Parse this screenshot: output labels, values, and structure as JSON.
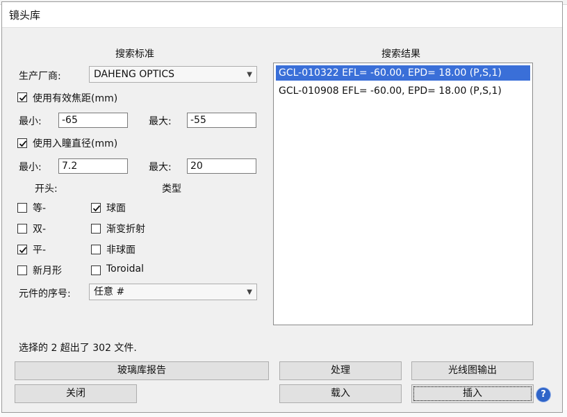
{
  "window": {
    "title": "镜头库"
  },
  "criteria": {
    "heading": "搜索标准",
    "manufacturer_label": "生产厂商:",
    "manufacturer_value": "DAHENG OPTICS",
    "use_efl_label": "使用有效焦距(mm)",
    "use_efl_checked": true,
    "efl_min_label": "最小:",
    "efl_min_value": "-65",
    "efl_max_label": "最大:",
    "efl_max_value": "-55",
    "use_epd_label": "使用入瞳直径(mm)",
    "use_epd_checked": true,
    "epd_min_label": "最小:",
    "epd_min_value": "7.2",
    "epd_max_label": "最大:",
    "epd_max_value": "20",
    "start_heading": "开头:",
    "type_heading": "类型",
    "start_options": [
      {
        "label": "等-",
        "checked": false
      },
      {
        "label": "双-",
        "checked": false
      },
      {
        "label": "平-",
        "checked": true
      },
      {
        "label": "新月形",
        "checked": false
      }
    ],
    "type_options": [
      {
        "label": "球面",
        "checked": true
      },
      {
        "label": "渐变折射",
        "checked": false
      },
      {
        "label": "非球面",
        "checked": false
      },
      {
        "label": "Toroidal",
        "checked": false
      }
    ],
    "element_index_label": "元件的序号:",
    "element_index_value": "任意 #"
  },
  "results": {
    "heading": "搜索结果",
    "items": [
      "GCL-010322 EFL= -60.00, EPD= 18.00 (P,S,1)",
      "GCL-010908 EFL= -60.00, EPD= 18.00 (P,S,1)"
    ],
    "selected_index": 0
  },
  "status": "选择的 2 超出了 302 文件.",
  "buttons": {
    "glass_report": "玻璃库报告",
    "process": "处理",
    "ray_export": "光线图输出",
    "close": "关闭",
    "load": "载入",
    "insert": "插入"
  },
  "icons": {
    "help": "?",
    "dropdown": "chevron-down-icon",
    "check": "check-icon"
  }
}
